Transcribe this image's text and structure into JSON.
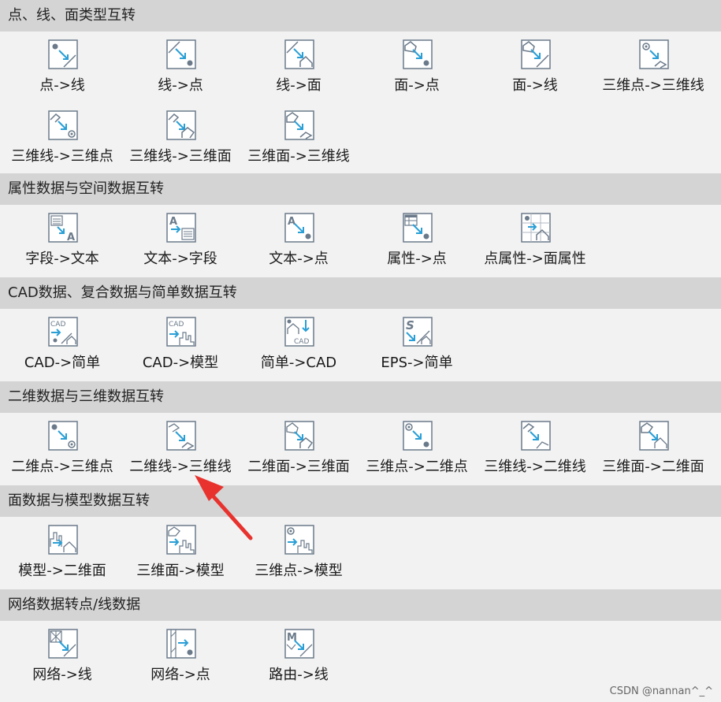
{
  "sections": [
    {
      "title": "点、线、面类型互转",
      "tools": [
        {
          "label": "点->线",
          "icon": "point-to-line-icon"
        },
        {
          "label": "线->点",
          "icon": "line-to-point-icon"
        },
        {
          "label": "线->面",
          "icon": "line-to-polygon-icon"
        },
        {
          "label": "面->点",
          "icon": "polygon-to-point-icon"
        },
        {
          "label": "面->线",
          "icon": "polygon-to-line-icon"
        },
        {
          "label": "三维点->三维线",
          "icon": "3d-point-to-3d-line-icon"
        },
        {
          "label": "三维线->三维点",
          "icon": "3d-line-to-3d-point-icon"
        },
        {
          "label": "三维线->三维面",
          "icon": "3d-line-to-3d-polygon-icon"
        },
        {
          "label": "三维面->三维线",
          "icon": "3d-polygon-to-3d-line-icon"
        }
      ]
    },
    {
      "title": "属性数据与空间数据互转",
      "tools": [
        {
          "label": "字段->文本",
          "icon": "field-to-text-icon"
        },
        {
          "label": "文本->字段",
          "icon": "text-to-field-icon"
        },
        {
          "label": "文本->点",
          "icon": "text-to-point-icon"
        },
        {
          "label": "属性->点",
          "icon": "attribute-to-point-icon"
        },
        {
          "label": "点属性->面属性",
          "icon": "point-attr-to-polygon-attr-icon"
        }
      ]
    },
    {
      "title": "CAD数据、复合数据与简单数据互转",
      "tools": [
        {
          "label": "CAD->简单",
          "icon": "cad-to-simple-icon"
        },
        {
          "label": "CAD->模型",
          "icon": "cad-to-model-icon"
        },
        {
          "label": "简单->CAD",
          "icon": "simple-to-cad-icon"
        },
        {
          "label": "EPS->简单",
          "icon": "eps-to-simple-icon"
        }
      ]
    },
    {
      "title": "二维数据与三维数据互转",
      "tools": [
        {
          "label": "二维点->三维点",
          "icon": "2d-point-to-3d-point-icon"
        },
        {
          "label": "二维线->三维线",
          "icon": "2d-line-to-3d-line-icon"
        },
        {
          "label": "二维面->三维面",
          "icon": "2d-polygon-to-3d-polygon-icon"
        },
        {
          "label": "三维点->二维点",
          "icon": "3d-point-to-2d-point-icon"
        },
        {
          "label": "三维线->二维线",
          "icon": "3d-line-to-2d-line-icon"
        },
        {
          "label": "三维面->二维面",
          "icon": "3d-polygon-to-2d-polygon-icon"
        }
      ]
    },
    {
      "title": "面数据与模型数据互转",
      "tools": [
        {
          "label": "模型->二维面",
          "icon": "model-to-2d-polygon-icon"
        },
        {
          "label": "三维面->模型",
          "icon": "3d-polygon-to-model-icon"
        },
        {
          "label": "三维点->模型",
          "icon": "3d-point-to-model-icon"
        }
      ]
    },
    {
      "title": "网络数据转点/线数据",
      "tools": [
        {
          "label": "网络->线",
          "icon": "network-to-line-icon"
        },
        {
          "label": "网络->点",
          "icon": "network-to-point-icon"
        },
        {
          "label": "路由->线",
          "icon": "route-to-line-icon"
        }
      ]
    }
  ],
  "watermark": "CSDN @nannan^_^",
  "colors": {
    "accent": "#2a9fd6",
    "icon_gray": "#6b7a8a",
    "header_bg": "#d4d4d4",
    "body_bg": "#f2f2f2",
    "annotation": "#e8322e"
  }
}
